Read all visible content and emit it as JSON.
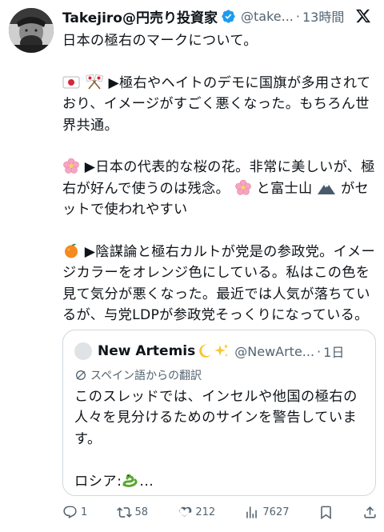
{
  "author": {
    "display_name": "Takejiro@円売り投資家",
    "handle": "@take...",
    "separator": "·",
    "time": "13時間"
  },
  "tweet": {
    "line_intro": "日本の極右のマークについて。",
    "p1_text": "▶極右やヘイトのデモに国旗が多用されており、イメージがすごく悪くなった。もちろん世界共通。",
    "p2_text_a": "▶日本の代表的な桜の花。非常に美しいが、極右が好んで使うのは残念。",
    "p2_text_b": "と富士山",
    "p2_text_c": "がセットで使われやすい",
    "p3_text": "▶陰謀論と極右カルトが党是の参政党。イメージカラーをオレンジ色にしている。私はこの色を見て気分が悪くなった。最近では人気が落ちているが、与党LDPが参政党そっくりになっている。"
  },
  "quote": {
    "display_name": "New Artemis",
    "handle": "@NewArte...",
    "separator": "·",
    "time": "1日",
    "translation_label": "スペイン語からの翻訳",
    "body_a": "このスレッドでは、インセルや他国の極右の人々を見分けるためのサインを警告しています。",
    "body_b_prefix": "ロシア:",
    "body_b_suffix": "..."
  },
  "actions": {
    "replies": "1",
    "reposts": "58",
    "likes": "212",
    "views": "7627"
  },
  "colors": {
    "text": "#0f1419",
    "secondary": "#536471",
    "verified": "#1d9bf0",
    "border": "#cfd9de"
  }
}
